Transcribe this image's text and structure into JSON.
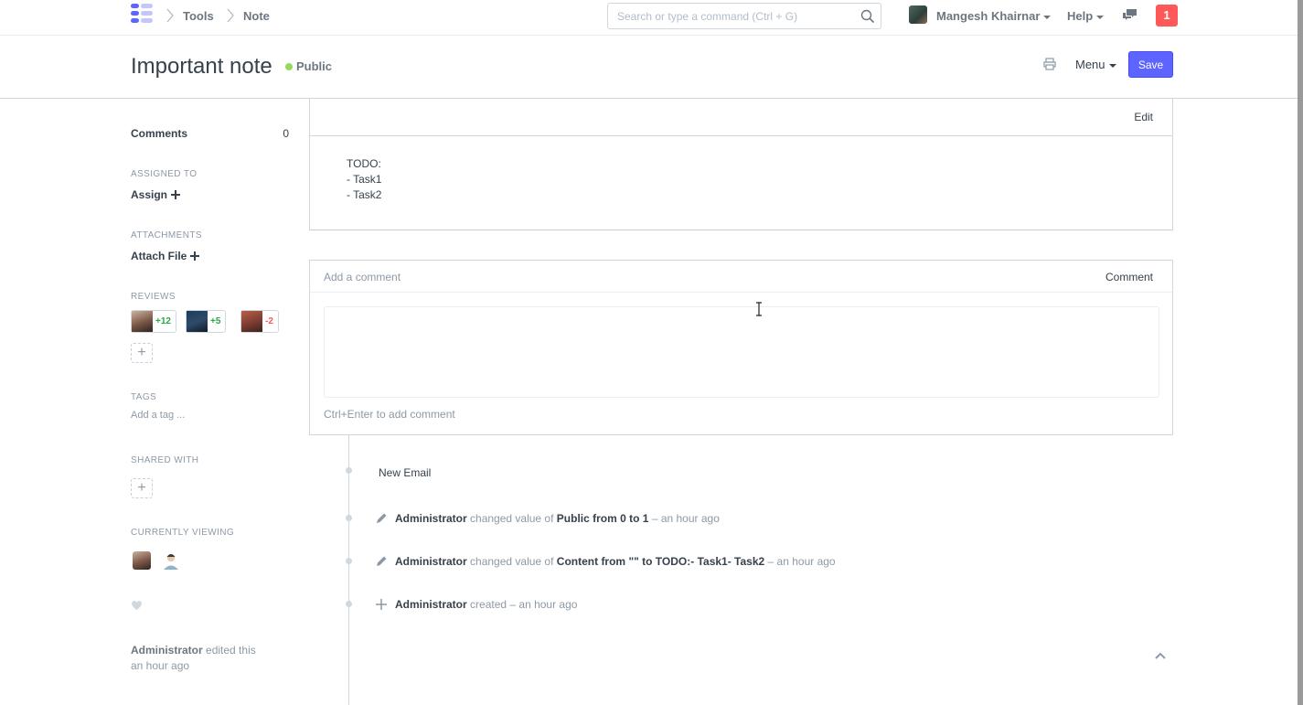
{
  "navbar": {
    "breadcrumbs": [
      "Tools",
      "Note"
    ],
    "search_placeholder": "Search or type a command (Ctrl + G)",
    "user_name": "Mangesh Khairnar",
    "help_label": "Help",
    "notification_count": "1",
    "colors": {
      "logo_primary": "#5e64ff",
      "logo_secondary": "#c3c6ff",
      "notification": "#ff5858"
    }
  },
  "page": {
    "title": "Important note",
    "visibility": "Public",
    "menu_label": "Menu",
    "save_label": "Save",
    "colors": {
      "save": "#5e64ff",
      "public_dot": "#98d85b"
    }
  },
  "sidebar": {
    "comments_label": "Comments",
    "comments_count": "0",
    "assigned_to_label": "Assigned To",
    "assign_label": "Assign",
    "attachments_label": "Attachments",
    "attach_label": "Attach File",
    "reviews_label": "Reviews",
    "reviews": [
      {
        "value": "+12",
        "color": "#28a745"
      },
      {
        "value": "+5",
        "color": "#28a745"
      },
      {
        "value": "-2",
        "color": "#ff5858"
      }
    ],
    "tags_label": "Tags",
    "tag_placeholder": "Add a tag ...",
    "shared_with_label": "Shared With",
    "currently_viewing_label": "Currently Viewing",
    "edited_user": "Administrator",
    "edited_text": "edited this",
    "edited_time": "an hour ago"
  },
  "form": {
    "edit_label": "Edit",
    "content_lines": [
      "TODO:",
      "- Task1",
      "- Task2"
    ]
  },
  "comment": {
    "title": "Add a comment",
    "button_label": "Comment",
    "hint": "Ctrl+Enter to add comment"
  },
  "timeline": {
    "new_email_label": "New Email",
    "items": [
      {
        "icon": "pencil-icon",
        "user": "Administrator",
        "text": "changed value of",
        "detail": "Public from 0 to 1",
        "time": "– an hour ago"
      },
      {
        "icon": "pencil-icon",
        "user": "Administrator",
        "text": "changed value of",
        "detail": "Content from \"\" to TODO:- Task1- Task2",
        "time": "– an hour ago"
      },
      {
        "icon": "plus-icon",
        "user": "Administrator",
        "text": "created – an hour ago"
      }
    ]
  }
}
